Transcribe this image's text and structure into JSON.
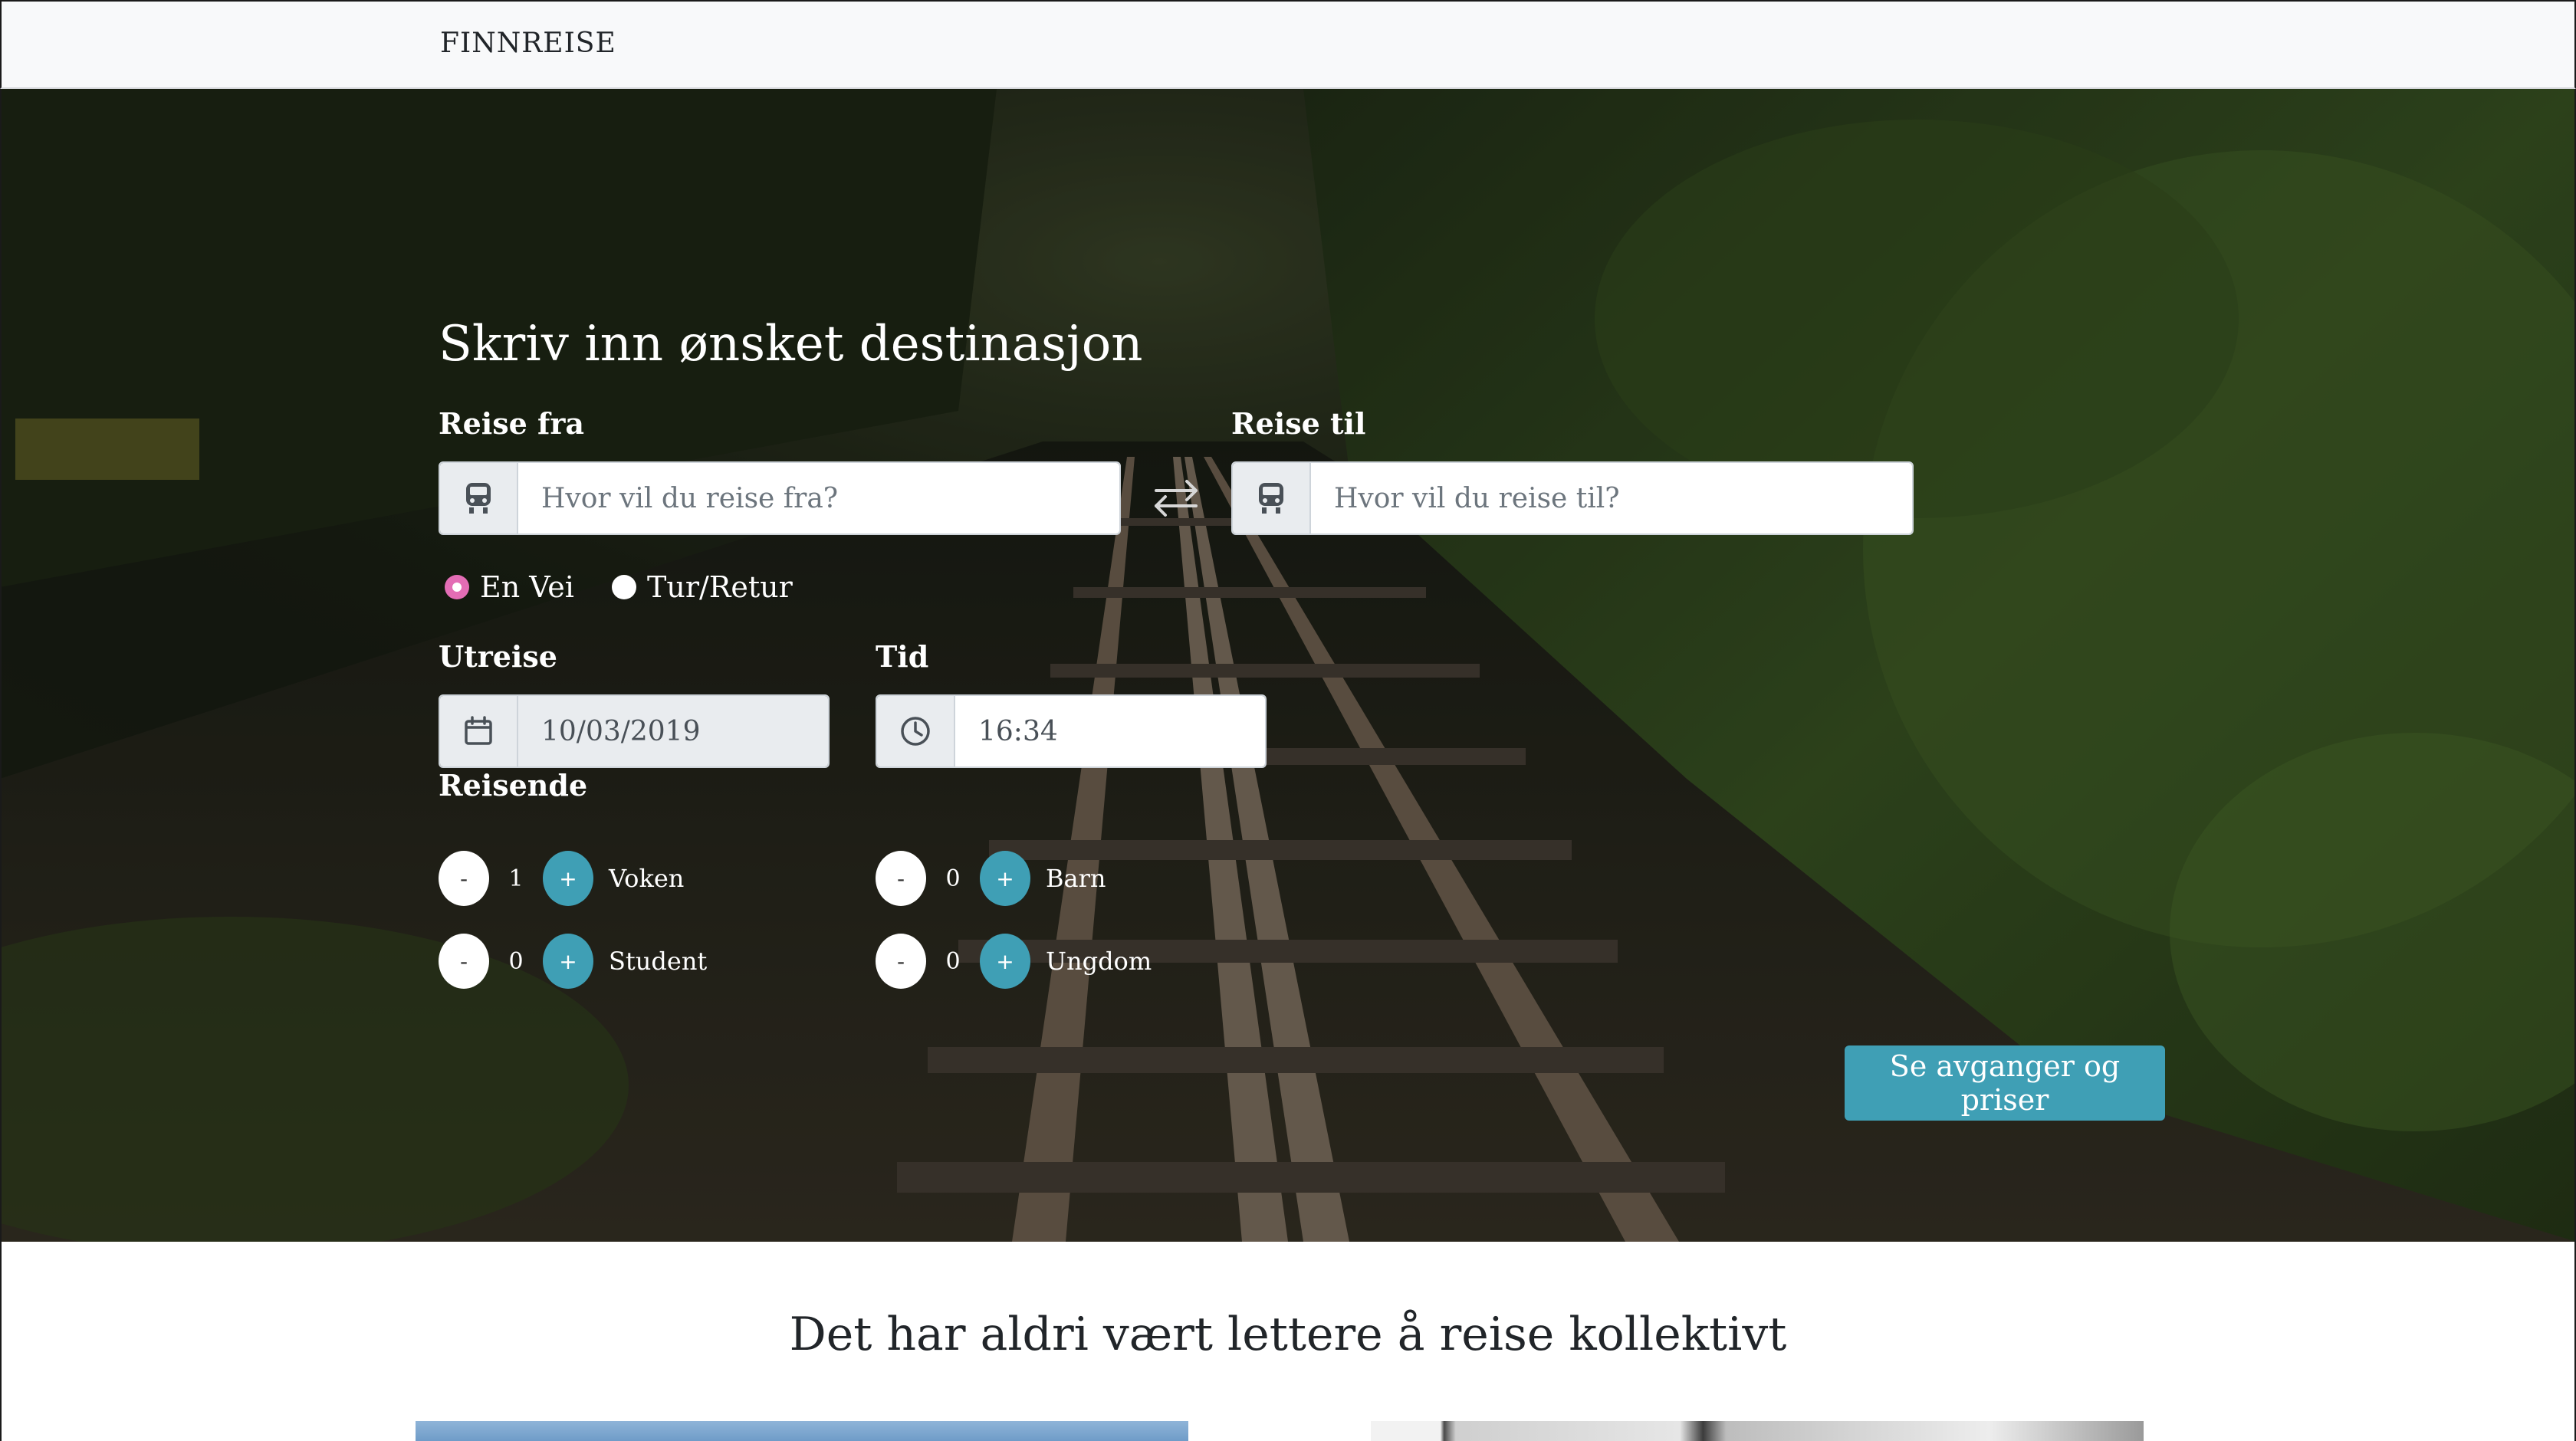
{
  "navbar": {
    "brand": "FINNREISE"
  },
  "hero": {
    "title": "Skriv inn ønsket destinasjon",
    "from": {
      "label": "Reise fra",
      "placeholder": "Hvor vil du reise fra?",
      "value": "",
      "icon": "train-icon"
    },
    "to": {
      "label": "Reise til",
      "placeholder": "Hvor vil du reise til?",
      "value": "",
      "icon": "train-icon"
    },
    "swap_icon": "swap-arrows-icon",
    "trip_type": {
      "options": [
        {
          "label": "En Vei",
          "checked": true
        },
        {
          "label": "Tur/Retur",
          "checked": false
        }
      ]
    },
    "departure": {
      "label": "Utreise",
      "value": "10/03/2019",
      "icon": "calendar-icon"
    },
    "time": {
      "label": "Tid",
      "value": "16:34",
      "icon": "clock-icon"
    },
    "travelers": {
      "label": "Reisende",
      "items": [
        {
          "label": "Voken",
          "count": "1"
        },
        {
          "label": "Barn",
          "count": "0"
        },
        {
          "label": "Student",
          "count": "0"
        },
        {
          "label": "Ungdom",
          "count": "0"
        }
      ],
      "minus_label": "-",
      "plus_label": "+"
    },
    "submit_label": "Se avganger og priser",
    "accent_color": "#3f9fb5",
    "radio_color": "#e36db5"
  },
  "section": {
    "tagline": "Det har aldri vært lettere å reise kollektivt"
  }
}
